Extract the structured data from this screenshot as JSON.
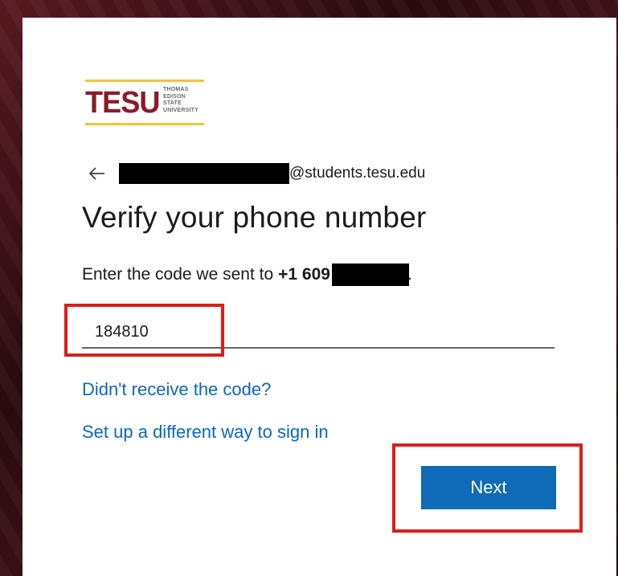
{
  "logo": {
    "wordmark": "TESU",
    "subtitle_lines": [
      "THOMAS",
      "EDISON",
      "STATE",
      "UNIVERSITY"
    ],
    "brand_color": "#8b1a2b",
    "accent_color": "#f2c33a"
  },
  "identity": {
    "back_icon": "arrow-left-icon",
    "email_domain": "@students.tesu.edu"
  },
  "page": {
    "title": "Verify your phone number",
    "description": "Enter the code we sent to",
    "phone_prefix": "+1 609",
    "phone_suffix": "."
  },
  "code_field": {
    "value": "184810"
  },
  "links": {
    "resend": "Didn't receive the code?",
    "different_method": "Set up a different way to sign in"
  },
  "actions": {
    "next_label": "Next",
    "primary_color": "#0f6ab8"
  },
  "annotations": {
    "highlight_color": "#e01b1b"
  }
}
